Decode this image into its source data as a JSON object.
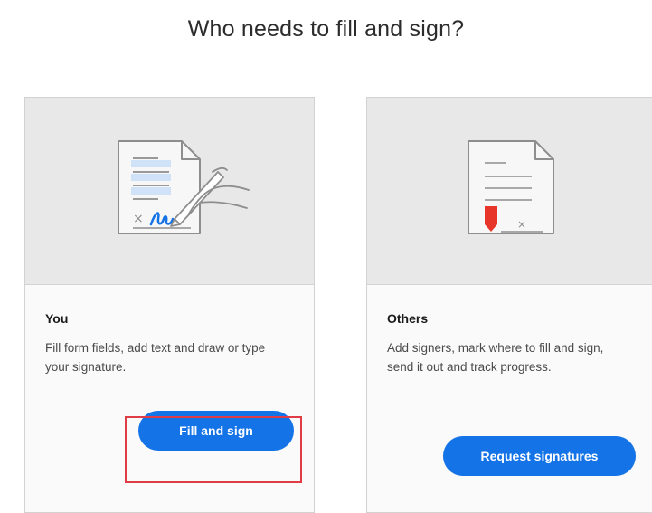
{
  "heading": "Who needs to fill and sign?",
  "cards": [
    {
      "title": "You",
      "description": "Fill form fields, add text and draw or type your signature.",
      "button_label": "Fill and sign",
      "illustration_icon": "document-pen-icon"
    },
    {
      "title": "Others",
      "description": "Add signers, mark where to fill and sign, send it out and track progress.",
      "button_label": "Request signatures",
      "illustration_icon": "document-signature-marker-icon"
    }
  ],
  "colors": {
    "accent": "#1473e6",
    "highlight": "#e03c45",
    "marker": "#e8352a"
  }
}
